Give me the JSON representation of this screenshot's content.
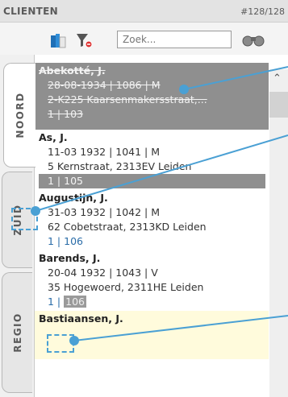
{
  "header": {
    "title": "CLIENTEN",
    "count": "#128/128"
  },
  "search": {
    "placeholder": "Zoek..."
  },
  "tabs": [
    {
      "label": "NOORD"
    },
    {
      "label": "ZUID"
    },
    {
      "label": "REGIO"
    }
  ],
  "records": [
    {
      "name": "Abekotté, J.",
      "details": "28-08-1934 | 1086 | M",
      "address": "2-K225 Kaarsenmakersstraat,...",
      "meta": "1 | 103"
    },
    {
      "name": "As, J.",
      "details": "11-03 1932 | 1041 | M",
      "address": "5 Kernstraat, 2313EV Leiden",
      "meta": "1 | 105"
    },
    {
      "name": "Augustijn, J.",
      "details": "31-03 1932 | 1042 | M",
      "address": "62 Cobetstraat, 2313KD Leiden",
      "meta": "1 | 106"
    },
    {
      "name": "Barends, J.",
      "details": "20-04 1932 | 1043 | V",
      "address": "35 Hogewoerd, 2311HE Leiden",
      "meta_prefix": "1 |",
      "meta_value": "106"
    },
    {
      "name": "Bastiaansen, J."
    }
  ],
  "colors": {
    "accent": "#4aa0d4",
    "deleted_bg": "#8f8f8f",
    "highlight_bg": "#fffbdc",
    "meta_text": "#2a6ca8"
  },
  "icons": [
    "books-icon",
    "filter-icon",
    "binoculars-icon",
    "scroll-up-icon"
  ]
}
